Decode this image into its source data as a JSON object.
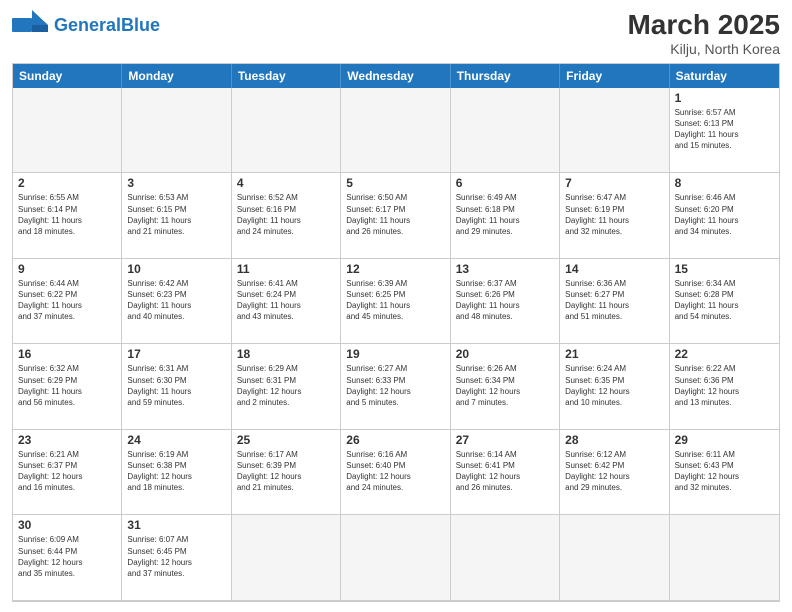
{
  "header": {
    "logo_general": "General",
    "logo_blue": "Blue",
    "month_year": "March 2025",
    "location": "Kilju, North Korea"
  },
  "days": [
    "Sunday",
    "Monday",
    "Tuesday",
    "Wednesday",
    "Thursday",
    "Friday",
    "Saturday"
  ],
  "cells": [
    {
      "date": "",
      "info": "",
      "empty": true
    },
    {
      "date": "",
      "info": "",
      "empty": true
    },
    {
      "date": "",
      "info": "",
      "empty": true
    },
    {
      "date": "",
      "info": "",
      "empty": true
    },
    {
      "date": "",
      "info": "",
      "empty": true
    },
    {
      "date": "",
      "info": "",
      "empty": true
    },
    {
      "date": "1",
      "info": "Sunrise: 6:57 AM\nSunset: 6:13 PM\nDaylight: 11 hours\nand 15 minutes.",
      "empty": false
    },
    {
      "date": "2",
      "info": "Sunrise: 6:55 AM\nSunset: 6:14 PM\nDaylight: 11 hours\nand 18 minutes.",
      "empty": false
    },
    {
      "date": "3",
      "info": "Sunrise: 6:53 AM\nSunset: 6:15 PM\nDaylight: 11 hours\nand 21 minutes.",
      "empty": false
    },
    {
      "date": "4",
      "info": "Sunrise: 6:52 AM\nSunset: 6:16 PM\nDaylight: 11 hours\nand 24 minutes.",
      "empty": false
    },
    {
      "date": "5",
      "info": "Sunrise: 6:50 AM\nSunset: 6:17 PM\nDaylight: 11 hours\nand 26 minutes.",
      "empty": false
    },
    {
      "date": "6",
      "info": "Sunrise: 6:49 AM\nSunset: 6:18 PM\nDaylight: 11 hours\nand 29 minutes.",
      "empty": false
    },
    {
      "date": "7",
      "info": "Sunrise: 6:47 AM\nSunset: 6:19 PM\nDaylight: 11 hours\nand 32 minutes.",
      "empty": false
    },
    {
      "date": "8",
      "info": "Sunrise: 6:46 AM\nSunset: 6:20 PM\nDaylight: 11 hours\nand 34 minutes.",
      "empty": false
    },
    {
      "date": "9",
      "info": "Sunrise: 6:44 AM\nSunset: 6:22 PM\nDaylight: 11 hours\nand 37 minutes.",
      "empty": false
    },
    {
      "date": "10",
      "info": "Sunrise: 6:42 AM\nSunset: 6:23 PM\nDaylight: 11 hours\nand 40 minutes.",
      "empty": false
    },
    {
      "date": "11",
      "info": "Sunrise: 6:41 AM\nSunset: 6:24 PM\nDaylight: 11 hours\nand 43 minutes.",
      "empty": false
    },
    {
      "date": "12",
      "info": "Sunrise: 6:39 AM\nSunset: 6:25 PM\nDaylight: 11 hours\nand 45 minutes.",
      "empty": false
    },
    {
      "date": "13",
      "info": "Sunrise: 6:37 AM\nSunset: 6:26 PM\nDaylight: 11 hours\nand 48 minutes.",
      "empty": false
    },
    {
      "date": "14",
      "info": "Sunrise: 6:36 AM\nSunset: 6:27 PM\nDaylight: 11 hours\nand 51 minutes.",
      "empty": false
    },
    {
      "date": "15",
      "info": "Sunrise: 6:34 AM\nSunset: 6:28 PM\nDaylight: 11 hours\nand 54 minutes.",
      "empty": false
    },
    {
      "date": "16",
      "info": "Sunrise: 6:32 AM\nSunset: 6:29 PM\nDaylight: 11 hours\nand 56 minutes.",
      "empty": false
    },
    {
      "date": "17",
      "info": "Sunrise: 6:31 AM\nSunset: 6:30 PM\nDaylight: 11 hours\nand 59 minutes.",
      "empty": false
    },
    {
      "date": "18",
      "info": "Sunrise: 6:29 AM\nSunset: 6:31 PM\nDaylight: 12 hours\nand 2 minutes.",
      "empty": false
    },
    {
      "date": "19",
      "info": "Sunrise: 6:27 AM\nSunset: 6:33 PM\nDaylight: 12 hours\nand 5 minutes.",
      "empty": false
    },
    {
      "date": "20",
      "info": "Sunrise: 6:26 AM\nSunset: 6:34 PM\nDaylight: 12 hours\nand 7 minutes.",
      "empty": false
    },
    {
      "date": "21",
      "info": "Sunrise: 6:24 AM\nSunset: 6:35 PM\nDaylight: 12 hours\nand 10 minutes.",
      "empty": false
    },
    {
      "date": "22",
      "info": "Sunrise: 6:22 AM\nSunset: 6:36 PM\nDaylight: 12 hours\nand 13 minutes.",
      "empty": false
    },
    {
      "date": "23",
      "info": "Sunrise: 6:21 AM\nSunset: 6:37 PM\nDaylight: 12 hours\nand 16 minutes.",
      "empty": false
    },
    {
      "date": "24",
      "info": "Sunrise: 6:19 AM\nSunset: 6:38 PM\nDaylight: 12 hours\nand 18 minutes.",
      "empty": false
    },
    {
      "date": "25",
      "info": "Sunrise: 6:17 AM\nSunset: 6:39 PM\nDaylight: 12 hours\nand 21 minutes.",
      "empty": false
    },
    {
      "date": "26",
      "info": "Sunrise: 6:16 AM\nSunset: 6:40 PM\nDaylight: 12 hours\nand 24 minutes.",
      "empty": false
    },
    {
      "date": "27",
      "info": "Sunrise: 6:14 AM\nSunset: 6:41 PM\nDaylight: 12 hours\nand 26 minutes.",
      "empty": false
    },
    {
      "date": "28",
      "info": "Sunrise: 6:12 AM\nSunset: 6:42 PM\nDaylight: 12 hours\nand 29 minutes.",
      "empty": false
    },
    {
      "date": "29",
      "info": "Sunrise: 6:11 AM\nSunset: 6:43 PM\nDaylight: 12 hours\nand 32 minutes.",
      "empty": false
    },
    {
      "date": "30",
      "info": "Sunrise: 6:09 AM\nSunset: 6:44 PM\nDaylight: 12 hours\nand 35 minutes.",
      "empty": false
    },
    {
      "date": "31",
      "info": "Sunrise: 6:07 AM\nSunset: 6:45 PM\nDaylight: 12 hours\nand 37 minutes.",
      "empty": false
    },
    {
      "date": "",
      "info": "",
      "empty": true
    },
    {
      "date": "",
      "info": "",
      "empty": true
    },
    {
      "date": "",
      "info": "",
      "empty": true
    },
    {
      "date": "",
      "info": "",
      "empty": true
    },
    {
      "date": "",
      "info": "",
      "empty": true
    }
  ]
}
